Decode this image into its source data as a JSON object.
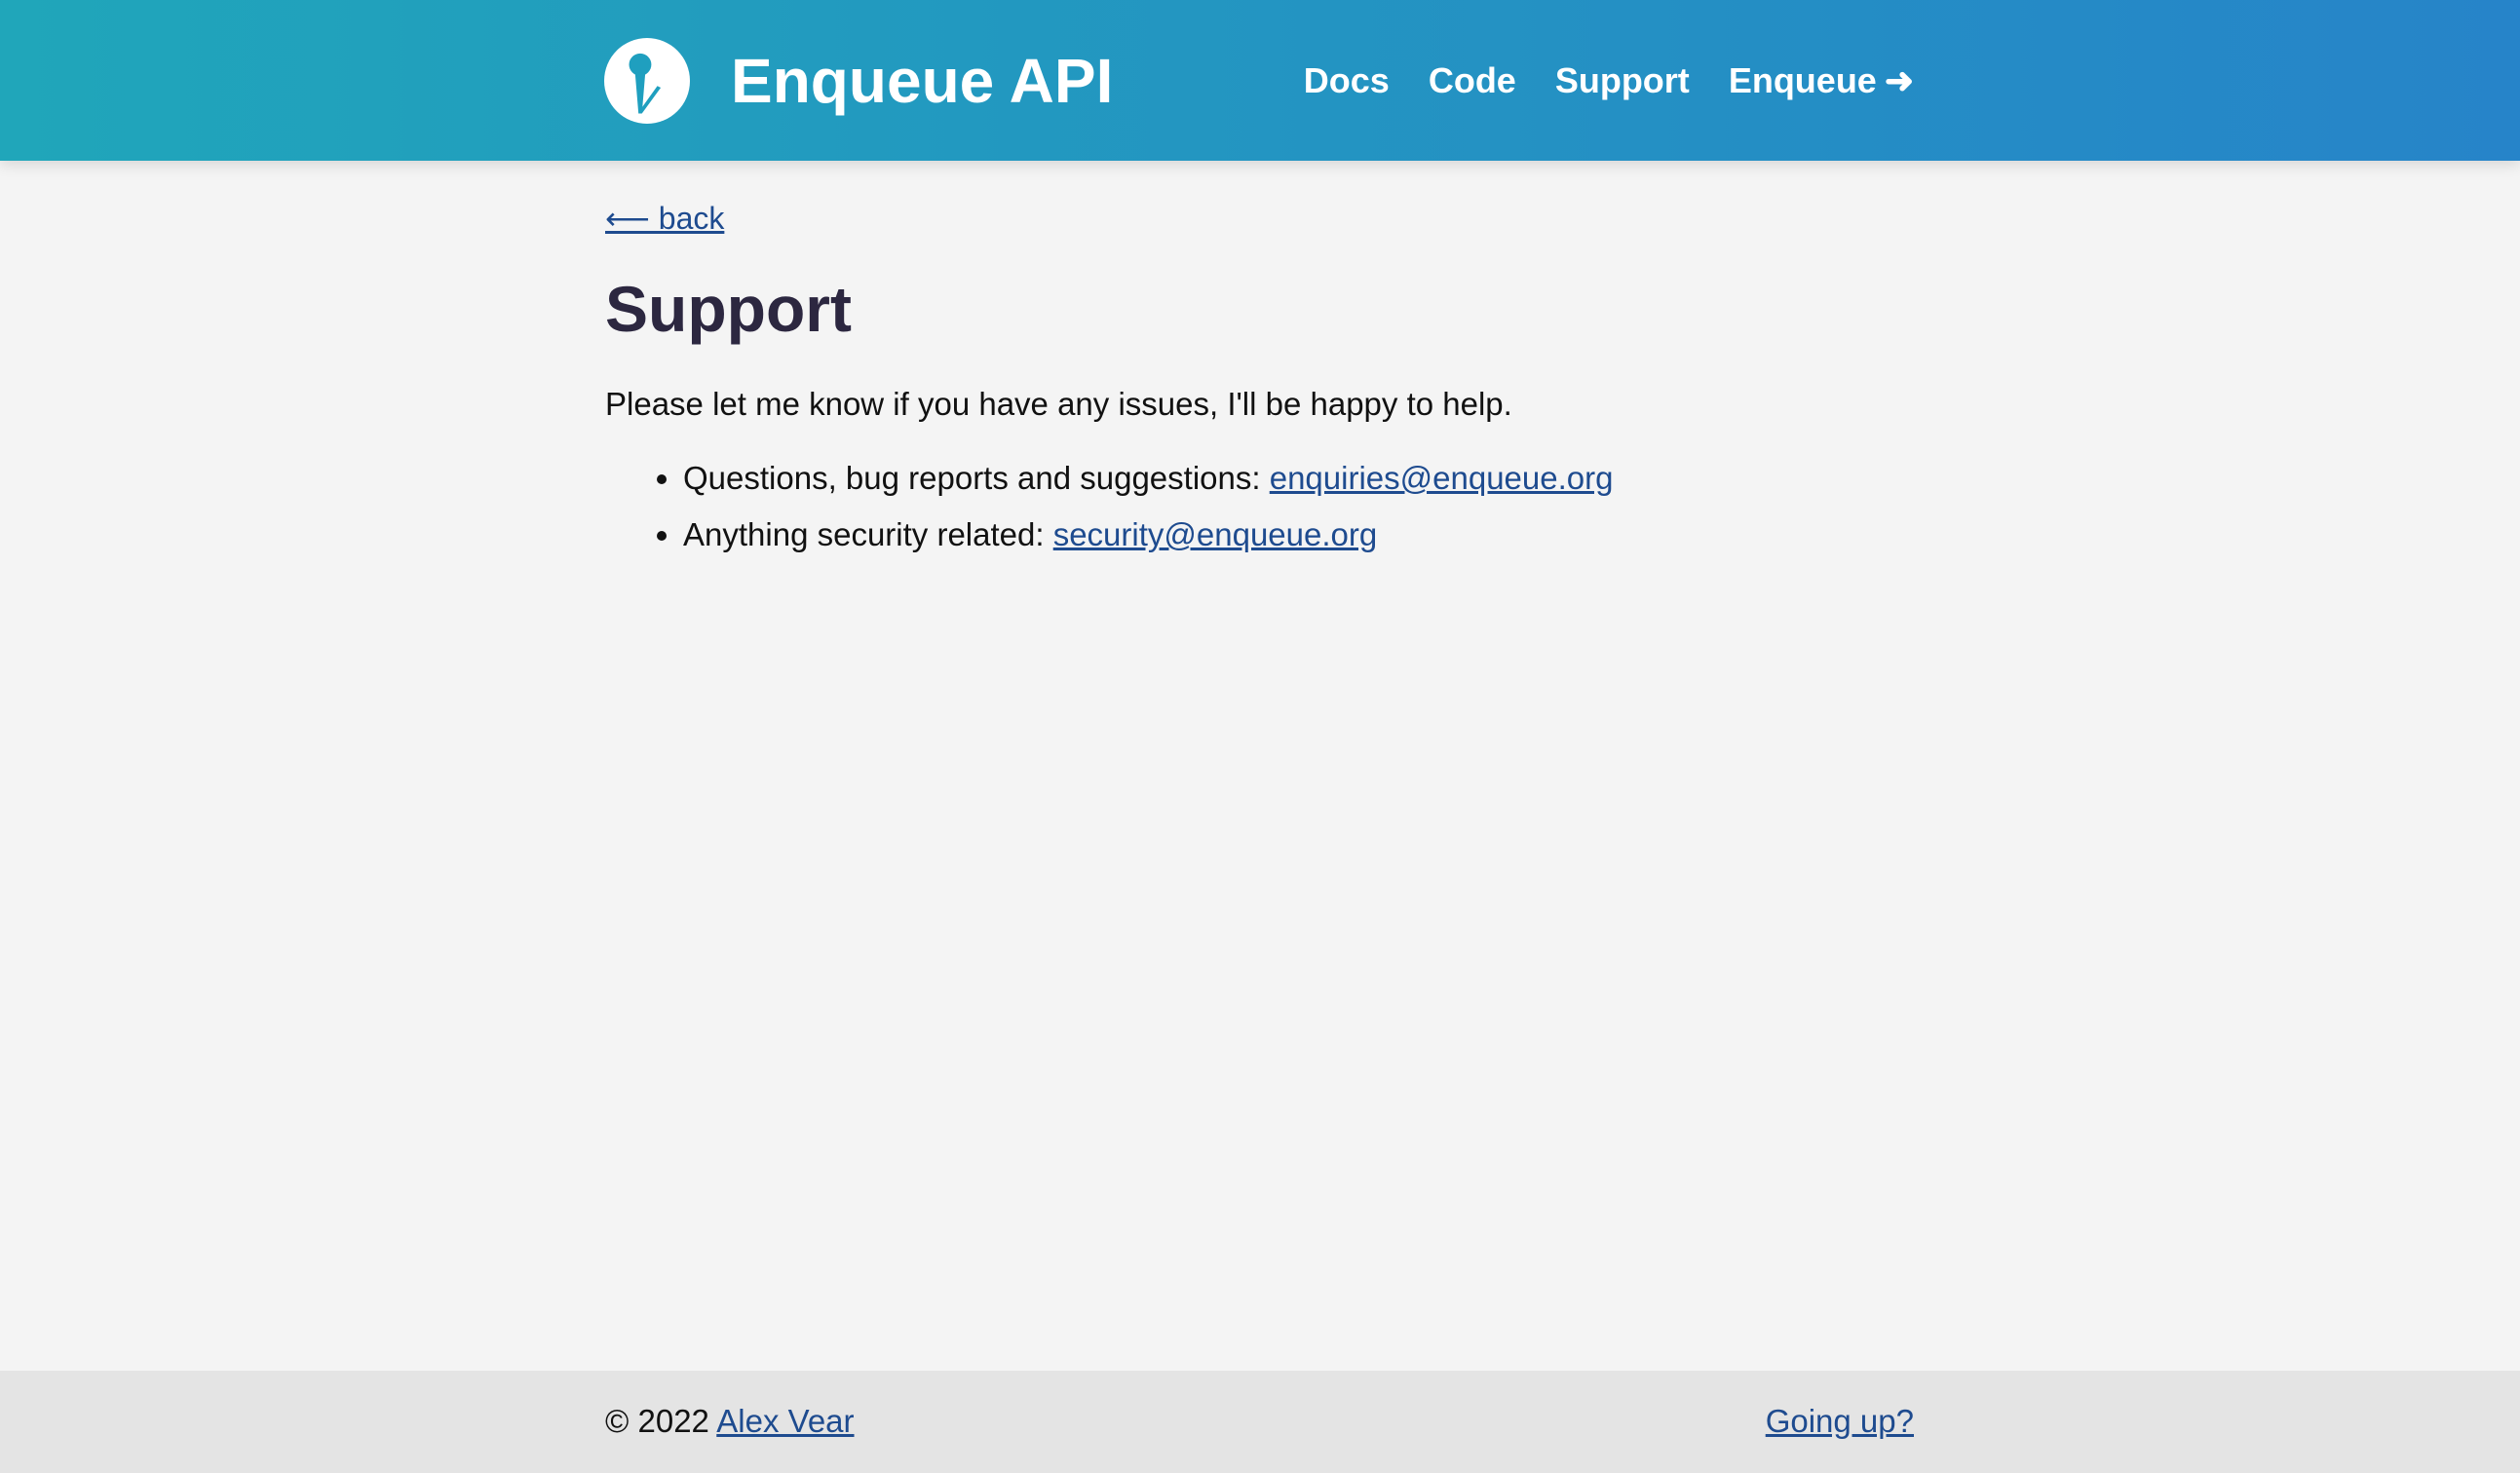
{
  "header": {
    "title": "Enqueue API",
    "logo_icon": "enqueue-logo-icon",
    "nav": [
      {
        "label": "Docs"
      },
      {
        "label": "Code"
      },
      {
        "label": "Support"
      },
      {
        "label": "Enqueue",
        "icon": "arrow-right-icon",
        "icon_glyph": "➜"
      }
    ],
    "colors": {
      "gradient_start": "#20a6ba",
      "gradient_end": "#2684c9"
    }
  },
  "main": {
    "back_label": "⟵ back",
    "heading": "Support",
    "intro": "Please let me know if you have any issues, I'll be happy to help.",
    "contacts": [
      {
        "label": "Questions, bug reports and suggestions:",
        "email": "enquiries@enqueue.org"
      },
      {
        "label": "Anything security related:",
        "email": "security@enqueue.org"
      }
    ]
  },
  "footer": {
    "copyright": "© 2022",
    "author": "Alex Vear",
    "going_up": "Going up?"
  },
  "colors": {
    "link": "#1e4b8f",
    "heading": "#2c2740",
    "background": "#f4f4f4",
    "footer_bg": "#e4e4e4"
  }
}
